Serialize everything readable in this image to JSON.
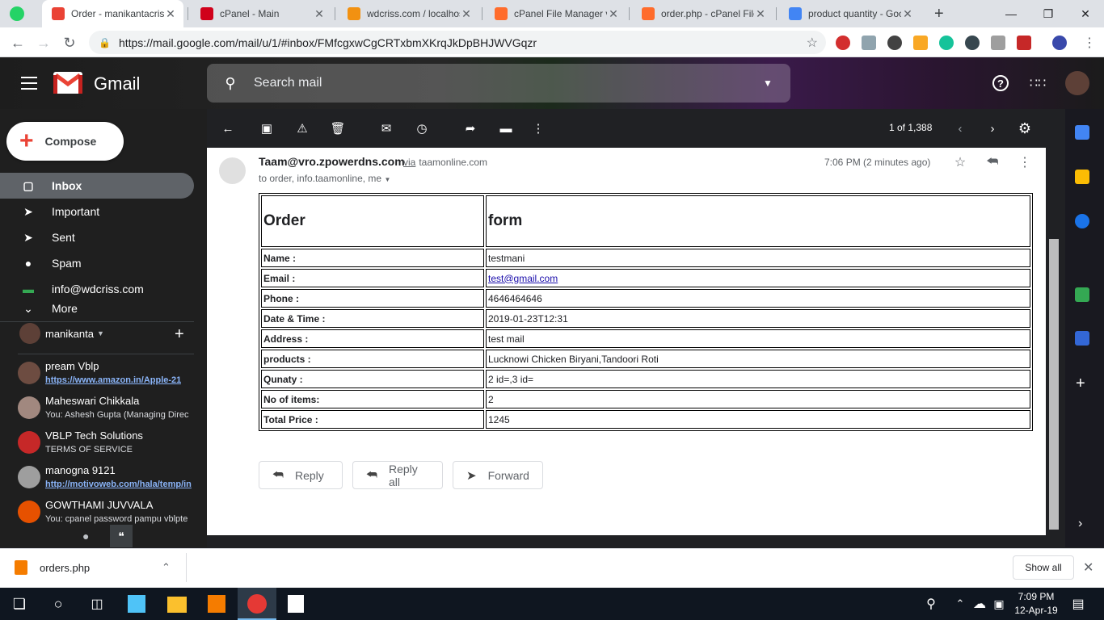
{
  "browser": {
    "tabs": [
      {
        "title": "Order - manikantacriss",
        "favicon": "gmail-icon",
        "color": "#ea4335"
      },
      {
        "title": "cPanel - Main",
        "favicon": "vivaldi-icon",
        "color": "#d0011b"
      },
      {
        "title": "wdcriss.com / localhos",
        "favicon": "phpmyadmin-icon",
        "color": "#f29111"
      },
      {
        "title": "cPanel File Manager v",
        "favicon": "cpanel-icon",
        "color": "#ff6c2c"
      },
      {
        "title": "order.php - cPanel File",
        "favicon": "cpanel-icon",
        "color": "#ff6c2c"
      },
      {
        "title": "product quantity - Goo",
        "favicon": "google-icon",
        "color": "#4285f4"
      }
    ],
    "new_tab_label": "+",
    "url": "https://mail.google.com/mail/u/1/#inbox/FMfcgxwCgCRTxbmXKrqJkDpBHJWVGqzr"
  },
  "gmail": {
    "brand": "Gmail",
    "search_placeholder": "Search mail",
    "compose_label": "Compose",
    "nav": [
      {
        "label": "Inbox",
        "icon": "inbox-icon",
        "selected": true
      },
      {
        "label": "Important",
        "icon": "important-icon",
        "selected": false
      },
      {
        "label": "Sent",
        "icon": "send-icon",
        "selected": false
      },
      {
        "label": "Spam",
        "icon": "spam-icon",
        "selected": false
      },
      {
        "label": "info@wdcriss.com",
        "icon": "label-icon",
        "selected": false
      },
      {
        "label": "More",
        "icon": "chevron-down-icon",
        "selected": false
      }
    ],
    "hangouts_user": "manikanta",
    "hangouts": [
      {
        "name": "pream Vblp",
        "sub": "https://www.amazon.in/Apple-21",
        "link": true,
        "color": "#6d4c41"
      },
      {
        "name": "Maheswari Chikkala",
        "sub": "You: Ashesh Gupta (Managing Direc",
        "link": false,
        "color": "#a1887f"
      },
      {
        "name": "VBLP Tech Solutions",
        "sub": "TERMS OF SERVICE",
        "link": false,
        "color": "#c62828"
      },
      {
        "name": "manogna 9121",
        "sub": "http://motivoweb.com/hala/temp/in",
        "link": true,
        "color": "#9e9e9e"
      },
      {
        "name": "GOWTHAMI JUVVALA",
        "sub": "You: cpanel password pampu vblpte",
        "link": false,
        "color": "#e65100"
      }
    ],
    "pager": "1 of 1,388"
  },
  "message": {
    "from": "Taam@vro.zpowerdns.com",
    "via_label": "via",
    "via_domain": "taamonline.com",
    "to": "to order, info.taamonline, me",
    "time": "7:06 PM (2 minutes ago)",
    "table_head": [
      "Order",
      "form"
    ],
    "rows": [
      {
        "key": "Name :",
        "value": "testmani"
      },
      {
        "key": "Email :",
        "value": "test@gmail.com",
        "link": true
      },
      {
        "key": "Phone :",
        "value": "4646464646"
      },
      {
        "key": "Date & Time :",
        "value": "2019-01-23T12:31"
      },
      {
        "key": "Address :",
        "value": "test mail"
      },
      {
        "key": "products :",
        "value": "Lucknowi Chicken Biryani,Tandoori Roti"
      },
      {
        "key": "Qunaty :",
        "value": "2 id=,3 id="
      },
      {
        "key": "No of items:",
        "value": "2"
      },
      {
        "key": "Total Price :",
        "value": "1245"
      }
    ],
    "buttons": {
      "reply": "Reply",
      "reply_all": "Reply all",
      "forward": "Forward"
    }
  },
  "downloads": {
    "file": "orders.php",
    "show_all": "Show all"
  },
  "taskbar": {
    "time": "7:09 PM",
    "date": "12-Apr-19"
  }
}
